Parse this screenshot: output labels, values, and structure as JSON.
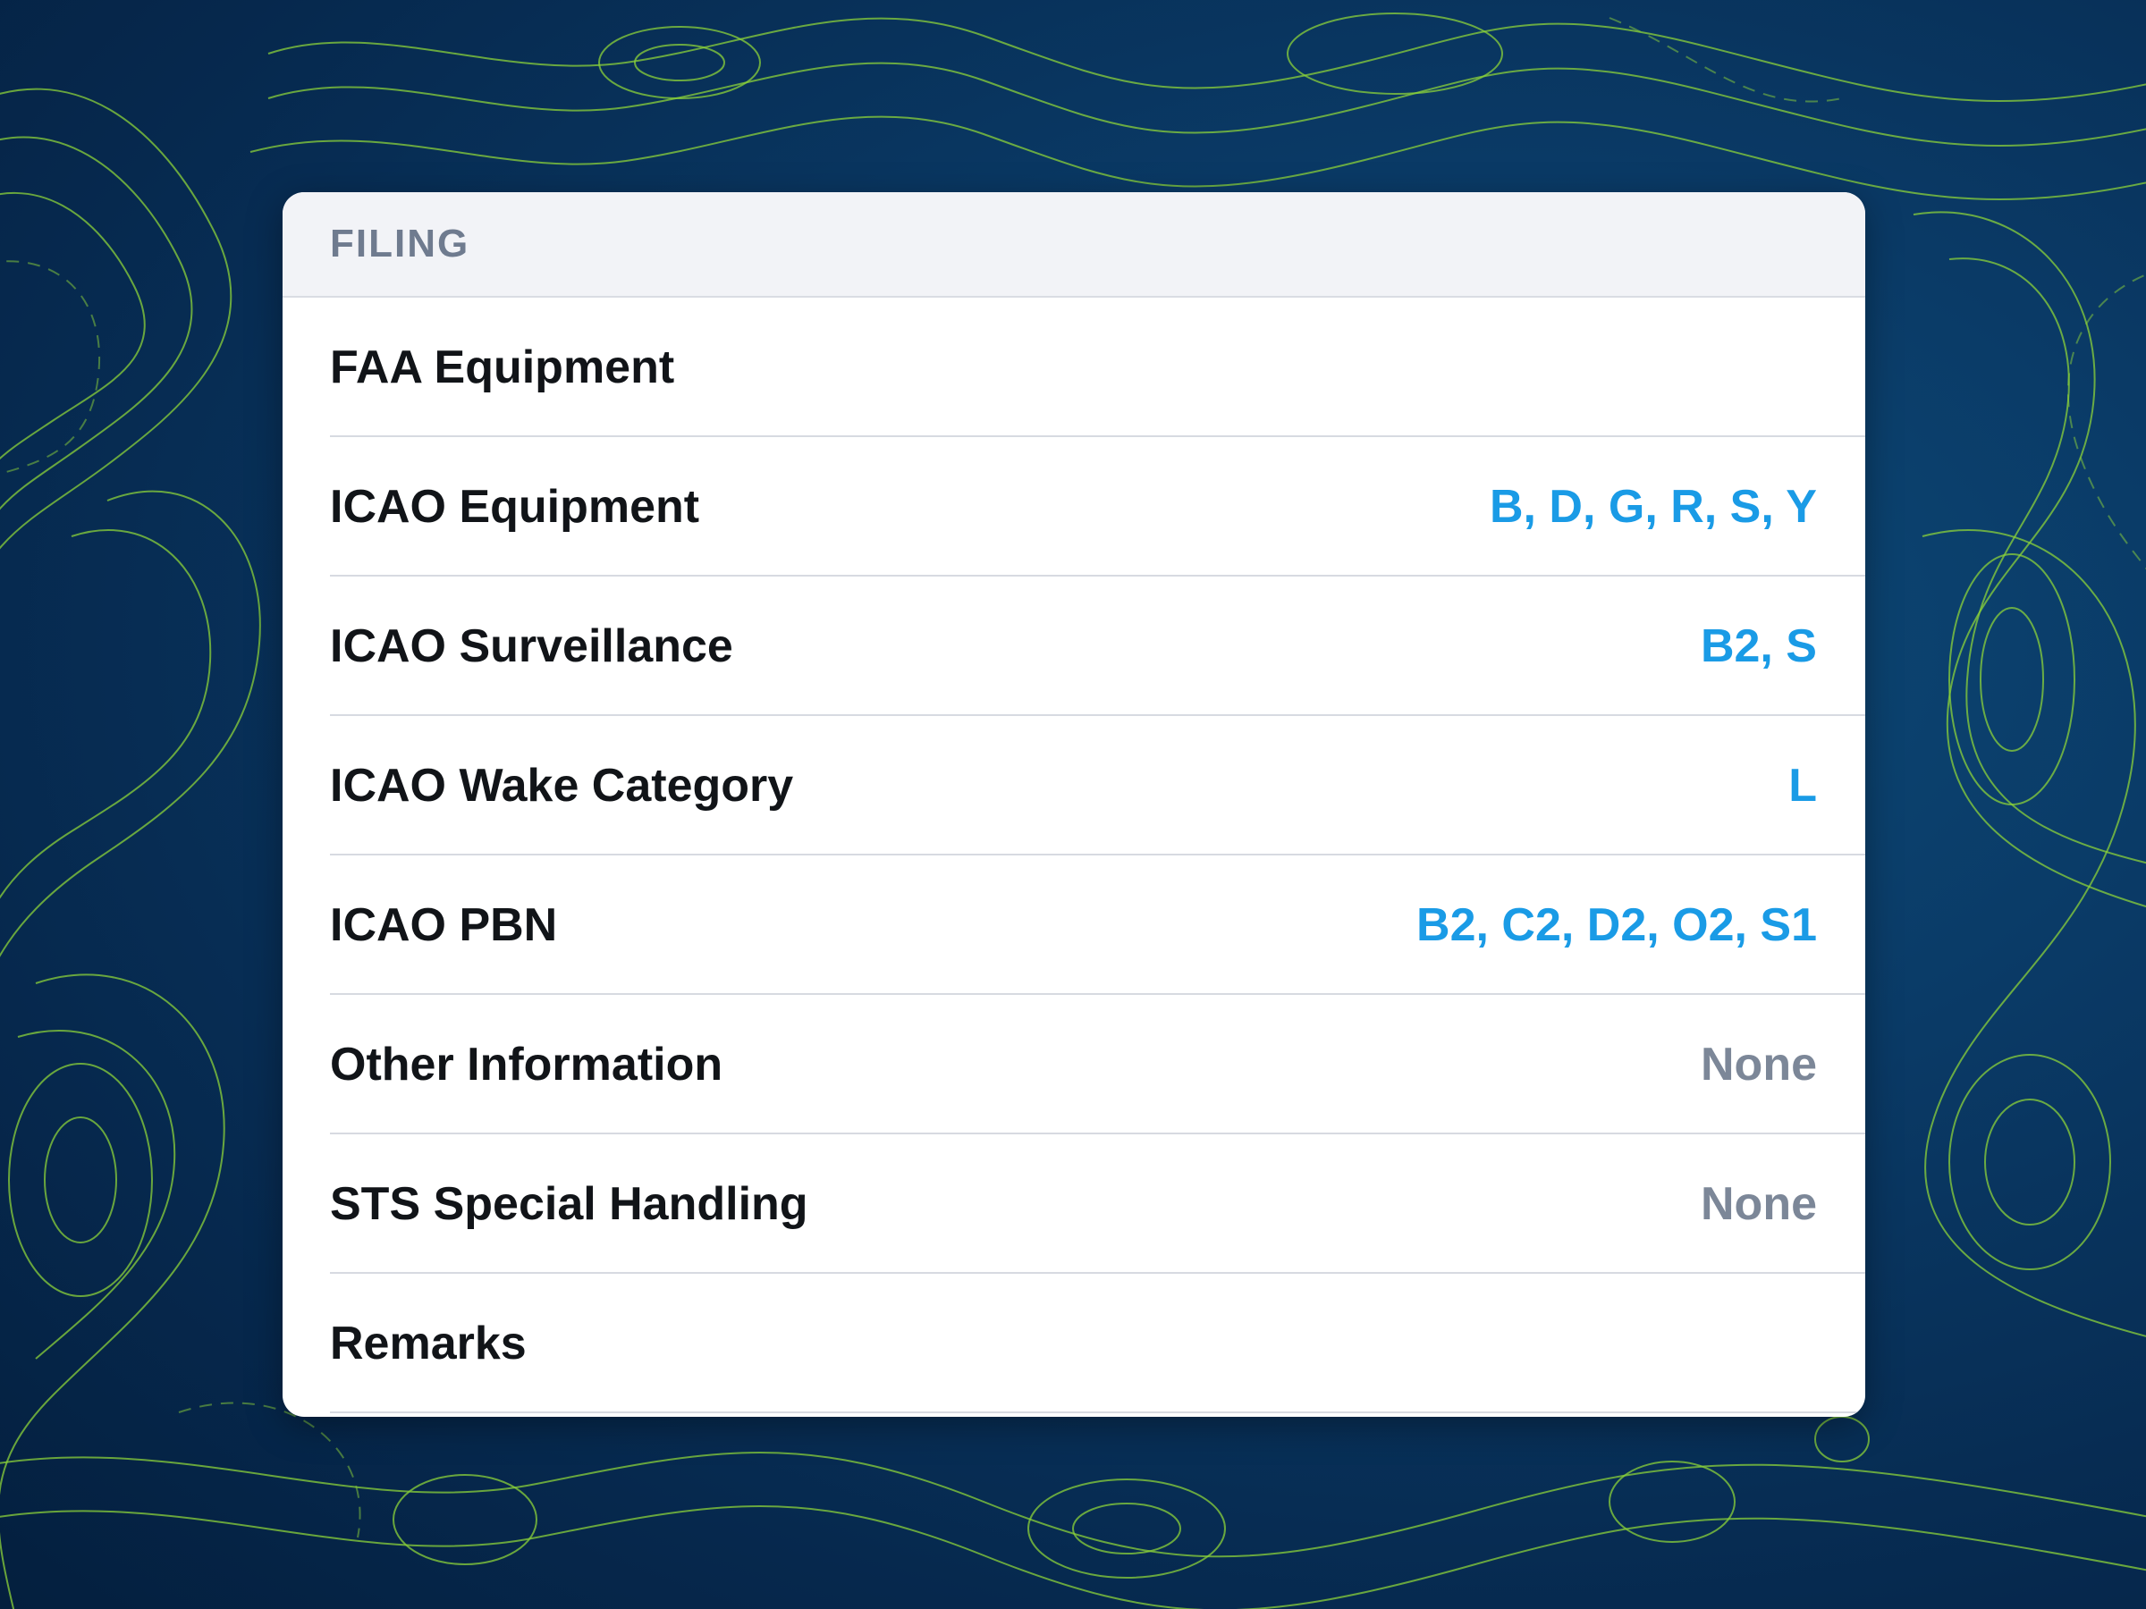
{
  "section": {
    "title": "FILING"
  },
  "rows": [
    {
      "label": "FAA Equipment",
      "value": ""
    },
    {
      "label": "ICAO Equipment",
      "value": "B, D, G, R, S, Y"
    },
    {
      "label": "ICAO Surveillance",
      "value": "B2, S"
    },
    {
      "label": "ICAO Wake Category",
      "value": "L"
    },
    {
      "label": "ICAO PBN",
      "value": "B2, C2, D2, O2, S1"
    },
    {
      "label": "Other Information",
      "value": "None"
    },
    {
      "label": "STS Special Handling",
      "value": "None"
    },
    {
      "label": "Remarks",
      "value": ""
    }
  ],
  "colors": {
    "background": "#06284d",
    "contour_lines": "#8bd13a",
    "value_set": "#1a9be6",
    "value_empty": "#7c8798",
    "header_text": "#6f7b8f"
  }
}
